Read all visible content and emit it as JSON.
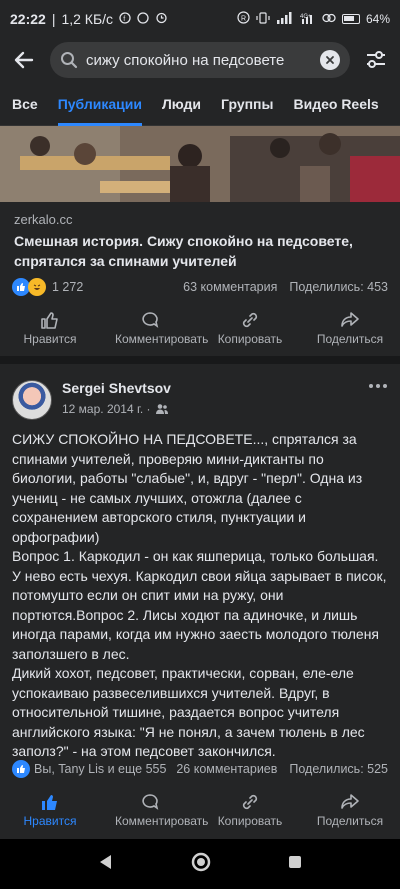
{
  "status": {
    "time": "22:22",
    "network_speed": "1,2 КБ/с",
    "battery": "64%",
    "icons": [
      "facebook-icon",
      "whatsapp-icon",
      "alarm-icon",
      "registered-icon",
      "vibrate-icon",
      "signal-icon",
      "4g-icon",
      "link-icon",
      "battery-icon"
    ]
  },
  "search": {
    "query": "сижу спокойно на педсовете"
  },
  "tabs": [
    {
      "label": "Все"
    },
    {
      "label": "Публикации"
    },
    {
      "label": "Люди"
    },
    {
      "label": "Группы"
    },
    {
      "label": "Видео Reels"
    }
  ],
  "active_tab": "Публикации",
  "post1": {
    "domain": "zerkalo.cc",
    "headline": "Смешная история. Сижу спокойно на педсовете, спрятался за спинами учителей",
    "reactions_count": "1 272",
    "comments": "63 комментария",
    "shares": "Поделились: 453",
    "actions": {
      "like": "Нравится",
      "comment": "Комментировать",
      "copy": "Копировать",
      "share": "Поделиться"
    }
  },
  "post2": {
    "author": "Sergei Shevtsov",
    "date": "12 мар. 2014 г. ·",
    "body": "СИЖУ СПОКОЙНО НА ПЕДСОВЕТЕ..., спрятался за спинами учителей, проверяю мини-диктанты по биологии, работы \"слабые\", и, вдруг - \"перл\". Одна из учениц - не самых лучших, отожгла (далее с сохранением авторского стиля, пунктуации и орфографии)\nВопрос 1. Каркодил - он как яшперица, только большая. У нево есть чехуя. Каркодил свои яйца зарывает в писок, потомушто если он спит ими на ружу, они портются.Вопрос 2. Лисы ходют па адиночке, и лишь иногда парами, когда им нужно заесть молодого тюленя заползшего в лес.\nДикий хохот, педсовет, практически, сорван, еле-еле успокаиваю развеселившихся учителей. Вдруг, в относительной тишине, раздается вопрос учителя английского языка: \"Я не понял, а зачем тюлень в лес заполз?\" - на этом педсовет закончился.",
    "reactions": "Вы, Tany Lis и еще 555",
    "comments": "26 комментариев",
    "shares": "Поделились: 525",
    "actions": {
      "like": "Нравится",
      "comment": "Комментировать",
      "copy": "Копировать",
      "share": "Поделиться"
    }
  },
  "colors": {
    "accent": "#2d88ff",
    "background": "#18191a",
    "card": "#242526",
    "text": "#e4e6eb",
    "muted": "#b0b3b8"
  }
}
